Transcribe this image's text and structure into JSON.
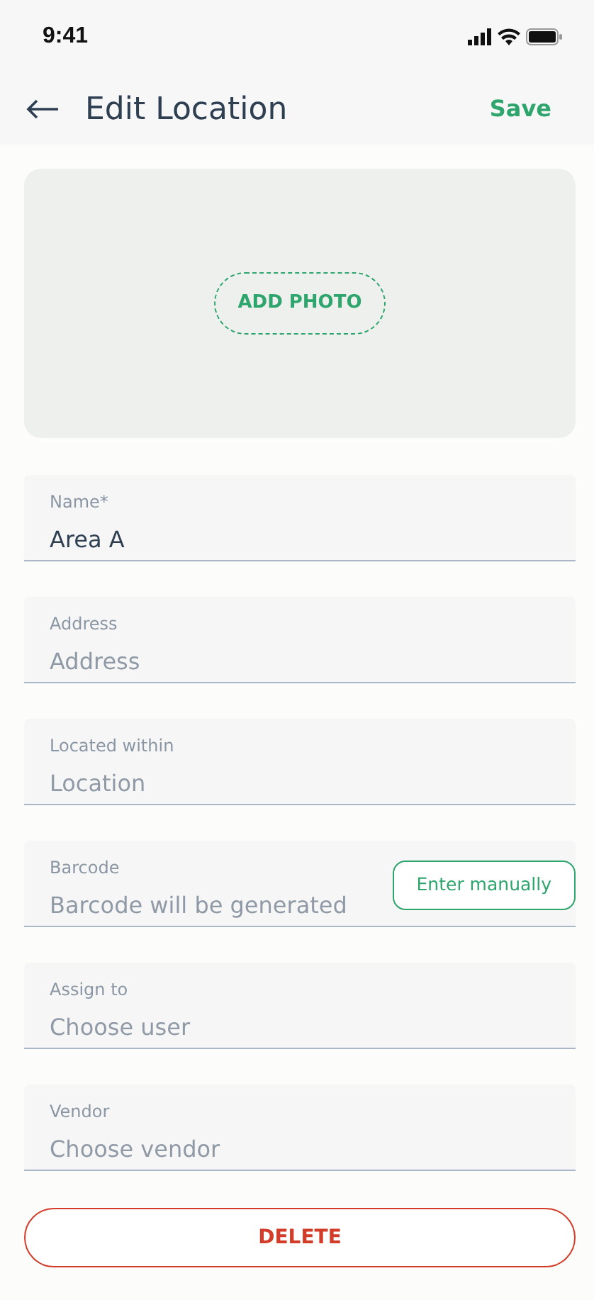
{
  "status_bar": {
    "time": "9:41"
  },
  "header": {
    "title": "Edit Location",
    "action": "Save"
  },
  "photo": {
    "button": "ADD PHOTO"
  },
  "fields": [
    {
      "label": "Name*",
      "value": "Area A"
    },
    {
      "label": "Address",
      "placeholder": "Address"
    },
    {
      "label": "Located within",
      "placeholder": "Location"
    },
    {
      "label": "Barcode",
      "placeholder": "Barcode will be generated",
      "button": "Enter manually"
    },
    {
      "label": "Assign to",
      "placeholder": "Choose user"
    },
    {
      "label": "Vendor",
      "placeholder": "Choose vendor"
    }
  ],
  "delete_button": "DELETE"
}
